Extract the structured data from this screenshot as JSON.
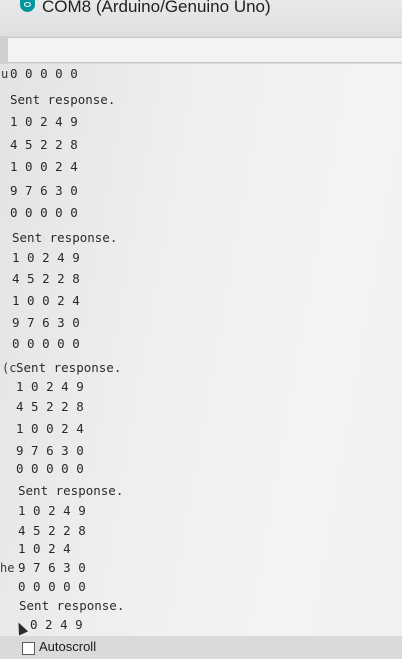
{
  "window": {
    "title": "COM8 (Arduino/Genuino Uno)"
  },
  "input": {
    "value": ""
  },
  "serial_lines": [
    "0 0 0 0 0",
    "Sent response.",
    "1 0 2 4 9",
    "4 5 2 2 8",
    "1 0 0 2 4",
    "9 7 6 3 0",
    "0 0 0 0 0",
    "Sent response.",
    "1 0 2 4 9",
    "4 5 2 2 8",
    "1 0 0 2 4",
    "9 7 6 3 0",
    "0 0 0 0 0",
    "Sent response.",
    "1 0 2 4 9",
    "4 5 2 2 8",
    "1 0 0 2 4",
    "9 7 6 3 0",
    "0 0 0 0 0",
    "Sent response.",
    "1 0 2 4 9",
    "4 5 2 2 8",
    "1 0 2 4",
    "9 7 6 3 0",
    "0 0 0 0 0",
    "Sent response.",
    "0 2 4 9"
  ],
  "gutter_fragments": {
    "a": "u",
    "b": "(c",
    "c": "he"
  },
  "footer": {
    "autoscroll_label": "Autoscroll",
    "autoscroll_checked": false
  }
}
